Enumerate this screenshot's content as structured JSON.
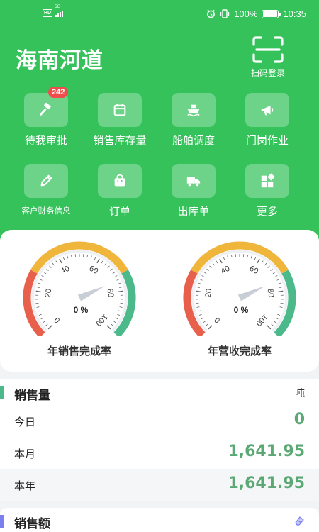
{
  "status_bar": {
    "badge": "HD",
    "network": "5G",
    "battery": "100%",
    "time": "10:35"
  },
  "app": {
    "title": "海南河道"
  },
  "scan": {
    "label": "扫码登录"
  },
  "grid": [
    {
      "label": "待我审批",
      "icon": "gavel-icon",
      "badge": "242"
    },
    {
      "label": "销售库存量",
      "icon": "calendar-icon"
    },
    {
      "label": "船舶调度",
      "icon": "ship-icon"
    },
    {
      "label": "门岗作业",
      "icon": "megaphone-icon"
    },
    {
      "label": "客户财务信息",
      "icon": "pencil-icon"
    },
    {
      "label": "订单",
      "icon": "shopping-bag-icon"
    },
    {
      "label": "出库单",
      "icon": "truck-icon"
    },
    {
      "label": "更多",
      "icon": "more-grid-icon"
    }
  ],
  "gauges": [
    {
      "title": "年销售完成率",
      "value": "0 %",
      "percent": 0,
      "ticks": [
        "0",
        "20",
        "40",
        "60",
        "80",
        "100"
      ]
    },
    {
      "title": "年营收完成率",
      "value": "0 %",
      "percent": 0,
      "ticks": [
        "0",
        "20",
        "40",
        "60",
        "80",
        "100"
      ]
    }
  ],
  "gauge_colors": {
    "low": "#e8604c",
    "mid": "#f0b63c",
    "high": "#4cb98a",
    "needle": "#c9ced6"
  },
  "sales_volume": {
    "title": "销售量",
    "unit": "吨",
    "bar_color": "#4cb98a",
    "rows": [
      {
        "label": "今日",
        "value": "0"
      },
      {
        "label": "本月",
        "value": "1,641.95"
      },
      {
        "label": "本年",
        "value": "1,641.95"
      }
    ]
  },
  "sales_amount": {
    "title": "销售额",
    "bar_color": "#7b7ff0",
    "icon": "eraser-icon"
  }
}
